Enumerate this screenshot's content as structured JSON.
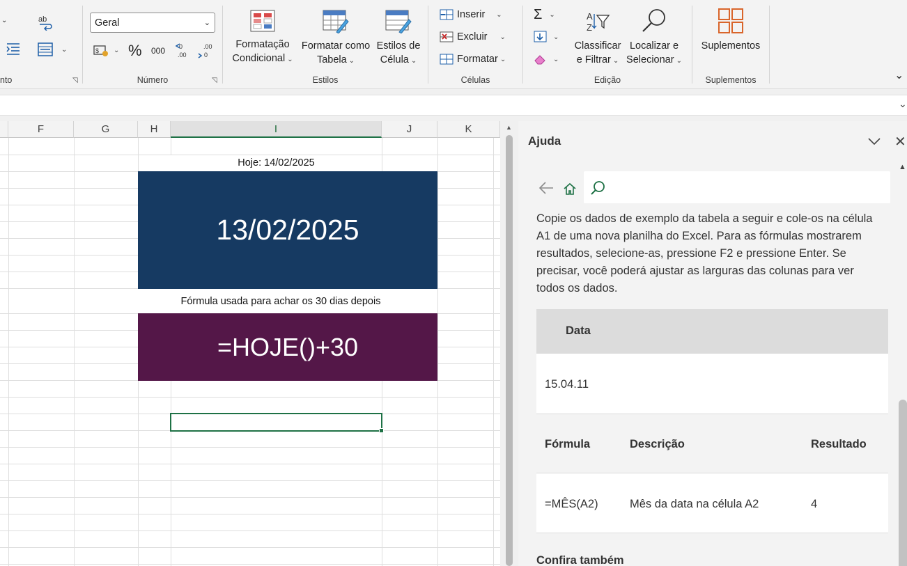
{
  "ribbon": {
    "alignment_group_label": "nto",
    "number_format": "Geral",
    "number_group_label": "Número",
    "percent_symbol": "%",
    "thousands_symbol": "000",
    "styles": {
      "conditional": [
        "Formatação",
        "Condicional"
      ],
      "format_table": [
        "Formatar como",
        "Tabela"
      ],
      "cell_styles": [
        "Estilos de",
        "Célula"
      ],
      "group_label": "Estilos"
    },
    "cells": {
      "insert": "Inserir",
      "delete": "Excluir",
      "format": "Formatar",
      "group_label": "Células"
    },
    "editing": {
      "sort_filter": [
        "Classificar",
        "e Filtrar"
      ],
      "find_select": [
        "Localizar e",
        "Selecionar"
      ],
      "group_label": "Edição"
    },
    "addins": {
      "button": "Suplementos",
      "group_label": "Suplementos"
    }
  },
  "sheet": {
    "columns": [
      "F",
      "G",
      "H",
      "I",
      "J",
      "K"
    ],
    "active_column": "I",
    "today_label": "Hoje: 14/02/2025",
    "date_value": "13/02/2025",
    "formula_caption": "Fórmula usada para achar os 30 dias depois",
    "formula_value": "=HOJE()+30"
  },
  "help": {
    "title": "Ajuda",
    "search_placeholder": "",
    "intro": "Copie os dados de exemplo da tabela a seguir e cole-os na célula A1 de uma nova planilha do Excel. Para as fórmulas mostrarem resultados, selecione-as, pressione F2 e pressione Enter. Se precisar, você poderá ajustar as larguras das colunas para ver todos os dados.",
    "data_header": "Data",
    "data_value": "15.04.11",
    "formula_table": {
      "headers": [
        "Fórmula",
        "Descrição",
        "Resultado"
      ],
      "row": [
        "=MÊS(A2)",
        "Mês da data na célula A2",
        "4"
      ]
    },
    "see_also": "Confira também"
  },
  "colors": {
    "blue_block": "#163a62",
    "purple_block": "#541748",
    "excel_green": "#1e7145"
  }
}
